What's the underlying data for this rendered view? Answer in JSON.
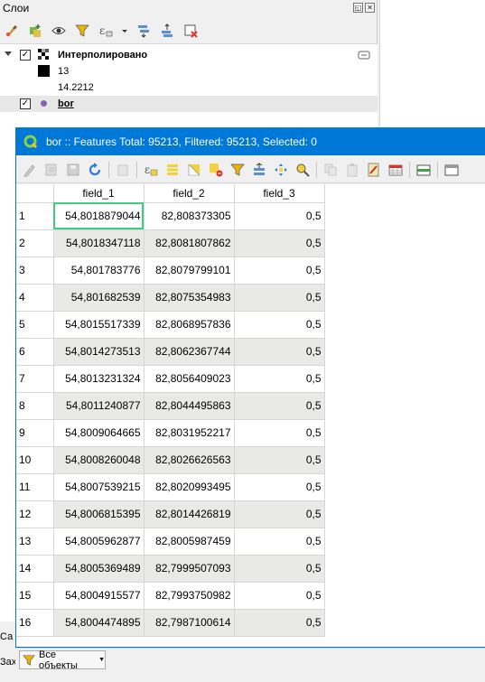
{
  "layers_panel": {
    "title": "Слои",
    "title_buttons": {
      "float": "◱",
      "close": "✕"
    },
    "toolbar_icons": [
      "open-layer-styling-icon",
      "add-group-icon",
      "manage-visibility-icon",
      "filter-legend-icon",
      "filter-by-expression-icon",
      "expand-all-icon",
      "collapse-all-icon",
      "remove-layer-icon"
    ],
    "layers": [
      {
        "name": "Интерполировано",
        "checked": true,
        "legend": [
          {
            "color": "#000000",
            "label": "13"
          },
          {
            "color": "#ffffff",
            "label": "14.2212"
          }
        ]
      },
      {
        "name": "bor",
        "checked": true
      }
    ]
  },
  "attribute_table": {
    "title": "bor :: Features Total: 95213, Filtered: 95213, Selected: 0",
    "columns": [
      "field_1",
      "field_2",
      "field_3"
    ],
    "rows": [
      {
        "id": "1",
        "f1": "54,8018879044",
        "f2": "82,808373305",
        "f3": "0,5"
      },
      {
        "id": "2",
        "f1": "54,8018347118",
        "f2": "82,8081807862",
        "f3": "0,5"
      },
      {
        "id": "3",
        "f1": "54,801783776",
        "f2": "82,8079799101",
        "f3": "0,5"
      },
      {
        "id": "4",
        "f1": "54,801682539",
        "f2": "82,8075354983",
        "f3": "0,5"
      },
      {
        "id": "5",
        "f1": "54,8015517339",
        "f2": "82,8068957836",
        "f3": "0,5"
      },
      {
        "id": "6",
        "f1": "54,8014273513",
        "f2": "82,8062367744",
        "f3": "0,5"
      },
      {
        "id": "7",
        "f1": "54,8013231324",
        "f2": "82,8056409023",
        "f3": "0,5"
      },
      {
        "id": "8",
        "f1": "54,8011240877",
        "f2": "82,8044495863",
        "f3": "0,5"
      },
      {
        "id": "9",
        "f1": "54,8009064665",
        "f2": "82,8031952217",
        "f3": "0,5"
      },
      {
        "id": "10",
        "f1": "54,8008260048",
        "f2": "82,8026626563",
        "f3": "0,5"
      },
      {
        "id": "11",
        "f1": "54,8007539215",
        "f2": "82,8020993495",
        "f3": "0,5"
      },
      {
        "id": "12",
        "f1": "54,8006815395",
        "f2": "82,8014426819",
        "f3": "0,5"
      },
      {
        "id": "13",
        "f1": "54,8005962877",
        "f2": "82,8005987459",
        "f3": "0,5"
      },
      {
        "id": "14",
        "f1": "54,8005369489",
        "f2": "82,7999507093",
        "f3": "0,5"
      },
      {
        "id": "15",
        "f1": "54,8004915577",
        "f2": "82,7993750982",
        "f3": "0,5"
      },
      {
        "id": "16",
        "f1": "54,8004474895",
        "f2": "82,7987100614",
        "f3": "0,5"
      }
    ],
    "filter_button_label": "Все объекты"
  },
  "left_edge": {
    "text_1": "Са",
    "text_2": "Зах"
  },
  "colors": {
    "titlebar": "#0078d7",
    "current_cell": "#3cce7d",
    "alt_row": "#e9e9e7"
  }
}
